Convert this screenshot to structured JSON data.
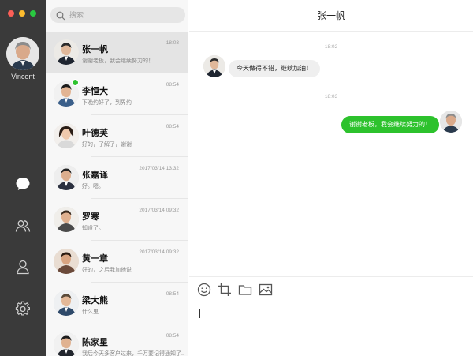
{
  "window": {
    "title": "张一帆"
  },
  "me": {
    "name": "Vincent"
  },
  "nav": {
    "icons": [
      "chat-bubble-icon",
      "contacts-icon",
      "profile-icon",
      "settings-gear-icon"
    ]
  },
  "search": {
    "placeholder": "搜索"
  },
  "contacts": [
    {
      "name": "张一帆",
      "preview": "谢谢老板，我会继续努力的！",
      "time": "18:03",
      "active": true,
      "unread": false
    },
    {
      "name": "李恒大",
      "preview": "下晚约好了，到界约",
      "time": "08:54",
      "active": false,
      "unread": true
    },
    {
      "name": "叶德芙",
      "preview": "好的，了解了，谢谢",
      "time": "08:54",
      "active": false,
      "unread": false
    },
    {
      "name": "张嘉译",
      "preview": "好。嗯。",
      "time": "2017/03/14 13:32",
      "active": false,
      "unread": false
    },
    {
      "name": "罗寒",
      "preview": "知道了。",
      "time": "2017/03/14 09:32",
      "active": false,
      "unread": false
    },
    {
      "name": "黄一章",
      "preview": "好的，之后我加他说",
      "time": "2017/03/14 09:32",
      "active": false,
      "unread": false
    },
    {
      "name": "梁大熊",
      "preview": "什么鬼...",
      "time": "08:54",
      "active": false,
      "unread": false
    },
    {
      "name": "陈家星",
      "preview": "我后今天多客户过来，千万要记得通知了...",
      "time": "08:54",
      "active": false,
      "unread": false
    }
  ],
  "conversation": {
    "title": "张一帆",
    "messages": [
      {
        "type": "timestamp",
        "text": "18:02"
      },
      {
        "type": "incoming",
        "text": "今天做得不错，继续加油！"
      },
      {
        "type": "timestamp",
        "text": "18:03"
      },
      {
        "type": "outgoing",
        "text": "谢谢老板，我会继续努力的！"
      }
    ]
  },
  "composer": {
    "tools": [
      "emoji-icon",
      "crop-icon",
      "folder-icon",
      "image-icon"
    ],
    "value": ""
  },
  "colors": {
    "sidebar": "#3a3a3a",
    "accent_green": "#2dc22d",
    "list_bg": "#f7f7f7",
    "active_item": "#e4e4e4",
    "incoming_bubble": "#efefef"
  }
}
